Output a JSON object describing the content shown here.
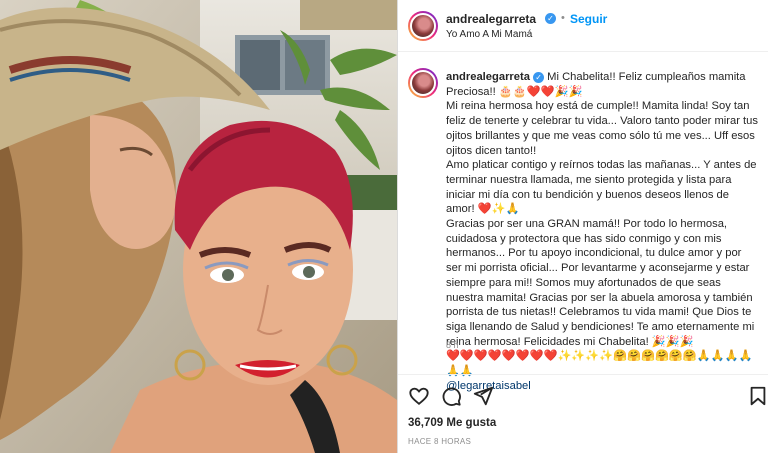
{
  "post": {
    "username": "andrealegarreta",
    "follow_label": "Seguir",
    "separator": "•",
    "audio_subtitle": "Yo Amo A Mi Mamá",
    "verified_icon": "✓"
  },
  "caption": {
    "username": "andrealegarreta",
    "lines": [
      "Mi Chabelita!! Feliz cumpleaños mamita",
      "Preciosa!! 🎂🎂❤️❤️🎉🎉",
      "Mi reina hermosa hoy está de cumple!! Mamita linda! Soy tan feliz de tenerte y celebrar tu vida... Valoro tanto poder mirar tus ojitos brillantes y que me veas como sólo tú me ves... Uff esos ojitos dicen tanto!!",
      "Amo platicar contigo y reírnos todas las mañanas... Y antes de terminar nuestra llamada, me siento protegida y lista para iniciar mi día con tu bendición y buenos deseos llenos de amor! ❤️✨🙏",
      "Gracias por ser una GRAN mamá!! Por todo lo hermosa, cuidadosa y protectora que has sido conmigo y con mis hermanos... Por tu apoyo incondicional, tu dulce amor y por ser mi porrista oficial... Por levantarme y aconsejarme y estar siempre para mi!! Somos muy afortunados de que seas nuestra mamita! Gracias por ser la abuela amorosa y también porrista de tus nietas!! Celebramos tu vida mami! Que Dios te siga llenando de Salud y bendiciones! Te amo eternamente mi reina hermosa! Felicidades mi Chabelita! 🎉🎉🎉",
      "❤️❤️❤️❤️❤️❤️❤️❤️✨✨✨✨🤗🤗🤗🤗🤗🤗🙏🙏🙏🙏🙏🙏"
    ],
    "mention": "@legarretaisabel",
    "time": "8 h"
  },
  "actions": {
    "likes": "36,709 Me gusta",
    "ago": "HACE 8 HORAS",
    "icons": [
      "heart-icon",
      "comment-icon",
      "share-icon",
      "bookmark-icon"
    ]
  },
  "colors": {
    "follow": "#0095f6",
    "verified": "#3897f0",
    "mention": "#00376b"
  }
}
